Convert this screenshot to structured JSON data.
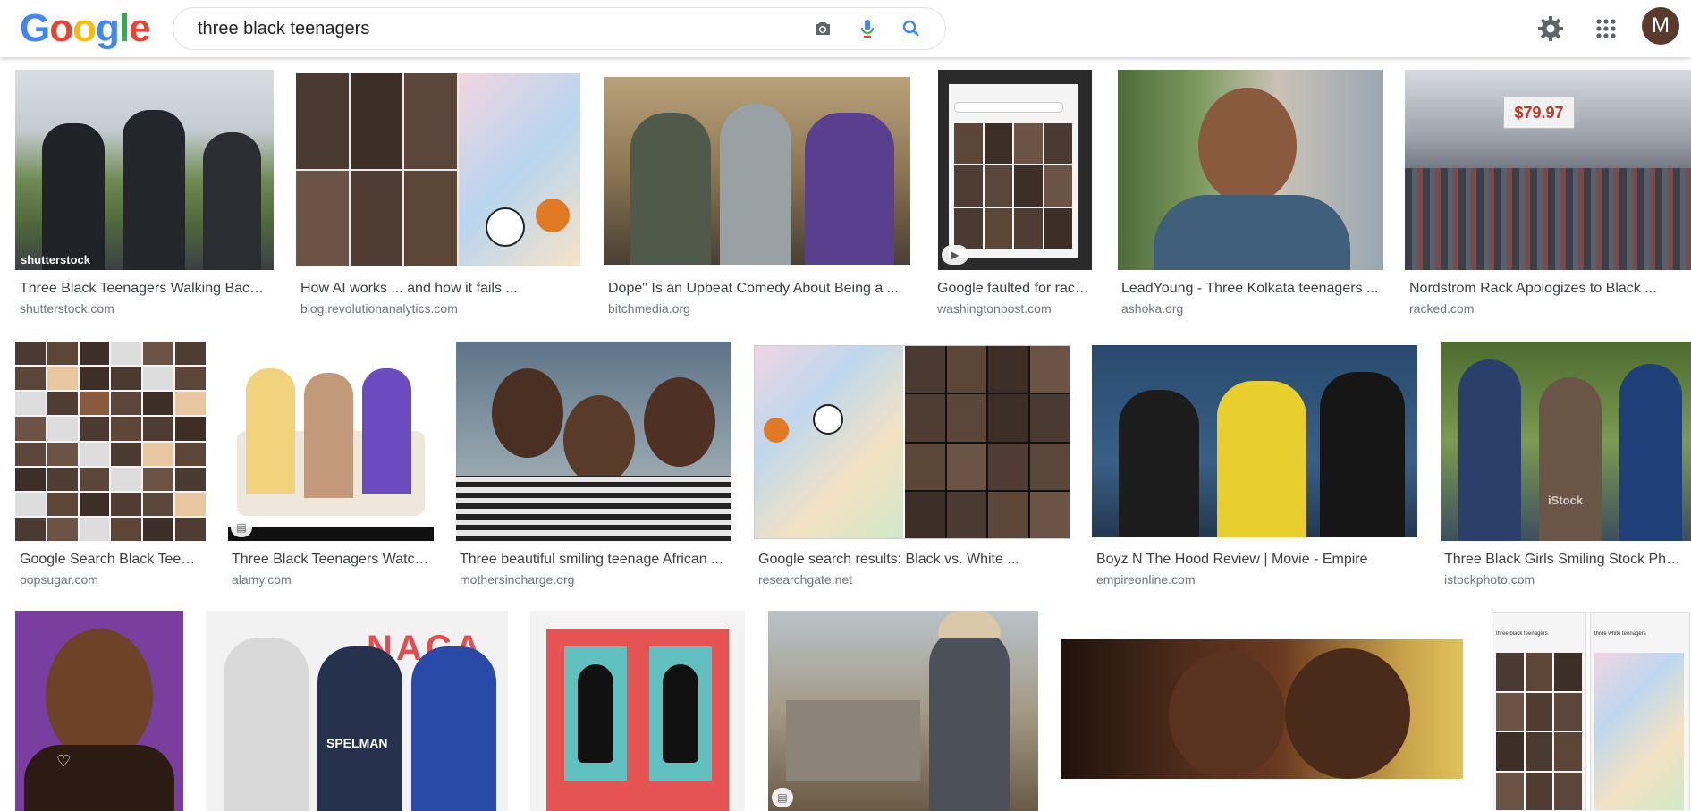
{
  "logo": {
    "g1": "G",
    "o1": "o",
    "o2": "o",
    "g2": "g",
    "l": "l",
    "e": "e"
  },
  "search": {
    "query": "three black teenagers"
  },
  "user": {
    "initial": "M"
  },
  "results": [
    {
      "title": "Three Black Teenagers Walking Backp...",
      "site": "shutterstock.com",
      "watermark": "shutterstock"
    },
    {
      "title": "How AI works ... and how it fails ...",
      "site": "blog.revolutionanalytics.com"
    },
    {
      "title": "Dope\" Is an Upbeat Comedy About Being a ...",
      "site": "bitchmedia.org"
    },
    {
      "title": "Google faulted for raci...",
      "site": "washingtonpost.com"
    },
    {
      "title": "LeadYoung - Three Kolkata teenagers ...",
      "site": "ashoka.org"
    },
    {
      "title": "Nordstrom Rack Apologizes to Black ...",
      "site": "racked.com",
      "price": "$79.97"
    },
    {
      "title": "Google Search Black Teena...",
      "site": "popsugar.com"
    },
    {
      "title": "Three Black Teenagers Watch ...",
      "site": "alamy.com"
    },
    {
      "title": "Three beautiful smiling teenage African ...",
      "site": "mothersincharge.org"
    },
    {
      "title": "Google search results: Black vs. White ...",
      "site": "researchgate.net"
    },
    {
      "title": "Boyz N The Hood Review | Movie - Empire",
      "site": "empireonline.com"
    },
    {
      "title": "Three Black Girls Smiling Stock Phot...",
      "site": "istockphoto.com",
      "watermark": "iStock"
    },
    {
      "title": "",
      "site": ""
    },
    {
      "title": "",
      "site": "",
      "sign": "SPELMAN"
    },
    {
      "title": "",
      "site": ""
    },
    {
      "title": "",
      "site": ""
    },
    {
      "title": "",
      "site": ""
    },
    {
      "title": "",
      "site": "",
      "phone_a": "three black teenagers",
      "phone_b": "three white teenagers"
    }
  ],
  "colors": {
    "g_blue": "#4285f4",
    "g_red": "#ea4335",
    "g_yellow": "#fbbc05",
    "g_green": "#34a853"
  }
}
